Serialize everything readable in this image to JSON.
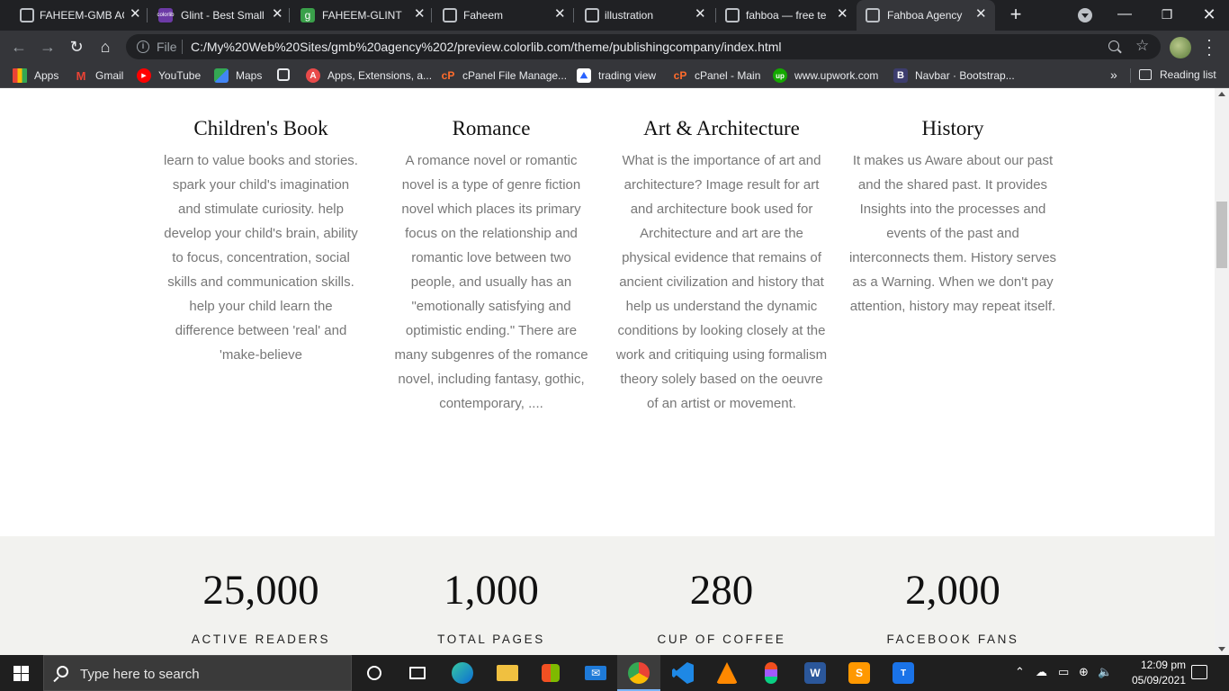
{
  "browser": {
    "tabs": [
      {
        "title": "FAHEEM-GMB AG",
        "favicon": "globe-icon",
        "active": false
      },
      {
        "title": "Glint - Best Small",
        "favicon": "colorlib-icon",
        "active": false
      },
      {
        "title": "FAHEEM-GLINT",
        "favicon": "glint-icon",
        "active": false
      },
      {
        "title": "Faheem",
        "favicon": "globe-icon",
        "active": false
      },
      {
        "title": "illustration",
        "favicon": "globe-icon",
        "active": false
      },
      {
        "title": "fahboa — free te",
        "favicon": "globe-icon",
        "active": false
      },
      {
        "title": "Fahboa Agency",
        "favicon": "globe-icon",
        "active": true
      }
    ],
    "address": {
      "scheme_label": "File",
      "url": "C:/My%20Web%20Sites/gmb%20agency%202/preview.colorlib.com/theme/publishingcompany/index.html"
    },
    "bookmarks": [
      {
        "label": "Apps",
        "icon": "apps-grid-icon"
      },
      {
        "label": "Gmail",
        "icon": "gmail-icon"
      },
      {
        "label": "YouTube",
        "icon": "youtube-icon"
      },
      {
        "label": "Maps",
        "icon": "maps-icon"
      },
      {
        "label": "",
        "icon": "globe-icon"
      },
      {
        "label": "Apps, Extensions, a...",
        "icon": "apps-extensions-icon"
      },
      {
        "label": "cPanel File Manage...",
        "icon": "cpanel-icon"
      },
      {
        "label": "trading view",
        "icon": "trading-view-icon"
      },
      {
        "label": "cPanel - Main",
        "icon": "cpanel-icon"
      },
      {
        "label": "www.upwork.com",
        "icon": "upwork-icon"
      },
      {
        "label": "Navbar · Bootstrap...",
        "icon": "bootstrap-icon"
      }
    ],
    "bookmarks_overflow": "»",
    "reading_list": "Reading list"
  },
  "page": {
    "categories": [
      {
        "title": "Children's Book",
        "text": "learn to value books and stories. spark your child's imagination and stimulate curiosity. help develop your child's brain, ability to focus, concentration, social skills and communication skills. help your child learn the difference between 'real' and 'make-believe"
      },
      {
        "title": "Romance",
        "text": "A romance novel or romantic novel is a type of genre fiction novel which places its primary focus on the relationship and romantic love between two people, and usually has an \"emotionally satisfying and optimistic ending.\" There are many subgenres of the romance novel, including fantasy, gothic, contemporary, ...."
      },
      {
        "title": "Art & Architecture",
        "text": "What is the importance of art and architecture? Image result for art and architecture book used for Architecture and art are the physical evidence that remains of ancient civilization and history that help us understand the dynamic conditions by looking closely at the work and critiquing using formalism theory solely based on the oeuvre of an artist or movement."
      },
      {
        "title": "History",
        "text": "It makes us Aware about our past and the shared past. It provides Insights into the processes and events of the past and interconnects them. History serves as a Warning. When we don't pay attention, history may repeat itself."
      }
    ],
    "stats": [
      {
        "value": "25,000",
        "label": "ACTIVE READERS"
      },
      {
        "value": "1,000",
        "label": "TOTAL PAGES"
      },
      {
        "value": "280",
        "label": "CUP OF COFFEE"
      },
      {
        "value": "2,000",
        "label": "FACEBOOK FANS"
      }
    ]
  },
  "taskbar": {
    "search_placeholder": "Type here to search",
    "time": "12:09 pm",
    "date": "05/09/2021",
    "apps": [
      {
        "name": "cortana-icon"
      },
      {
        "name": "task-view-icon"
      },
      {
        "name": "edge-icon"
      },
      {
        "name": "file-explorer-icon"
      },
      {
        "name": "microsoft-store-icon"
      },
      {
        "name": "mail-icon"
      },
      {
        "name": "chrome-icon"
      },
      {
        "name": "vscode-icon"
      },
      {
        "name": "vlc-icon"
      },
      {
        "name": "figma-icon"
      },
      {
        "name": "word-icon"
      },
      {
        "name": "sublime-text-icon"
      },
      {
        "name": "typora-icon"
      }
    ]
  },
  "colors": {
    "tab_strip": "#202124",
    "toolbar": "#35363a",
    "stats_band": "#f2f2ef",
    "taskbar": "#1f1f1f",
    "body_text": "#777777"
  }
}
